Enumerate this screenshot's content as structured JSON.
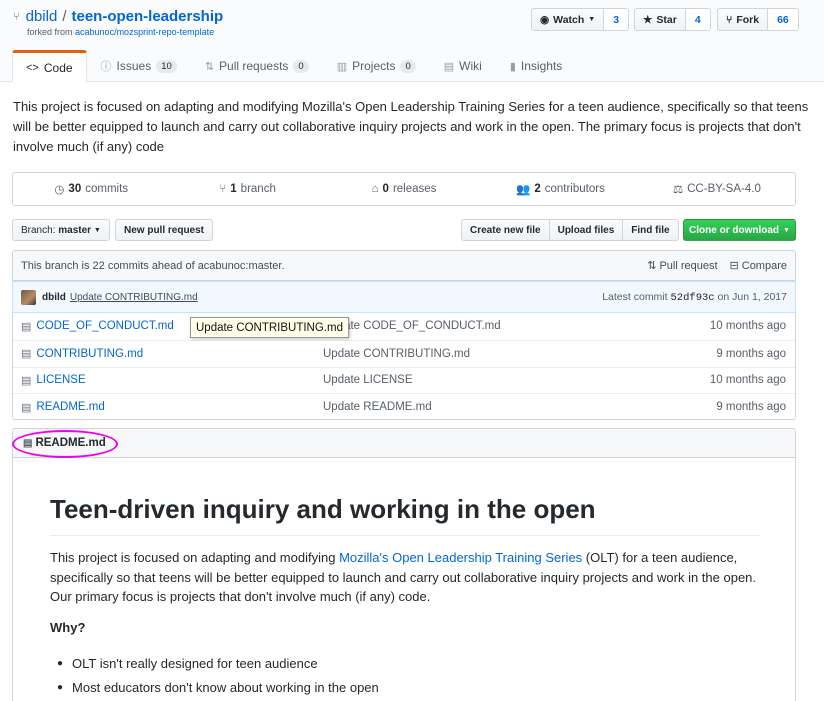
{
  "repo": {
    "owner": "dbild",
    "separator": "/",
    "name": "teen-open-leadership",
    "forked_prefix": "forked from",
    "forked_from": "acabunoc/mozsprint-repo-template"
  },
  "actions": {
    "watch_label": "Watch",
    "watch_count": "3",
    "star_label": "Star",
    "star_count": "4",
    "fork_label": "Fork",
    "fork_count": "66"
  },
  "tabs": [
    {
      "label": "Code",
      "icon": "code-icon"
    },
    {
      "label": "Issues",
      "count": "10",
      "icon": "issue-icon"
    },
    {
      "label": "Pull requests",
      "count": "0",
      "icon": "pull-request-icon"
    },
    {
      "label": "Projects",
      "count": "0",
      "icon": "project-icon"
    },
    {
      "label": "Wiki",
      "icon": "book-icon"
    },
    {
      "label": "Insights",
      "icon": "graph-icon"
    }
  ],
  "description": "This project is focused on adapting and modifying Mozilla's Open Leadership Training Series for a teen audience, specifically so that teens will be better equipped to launch and carry out collaborative inquiry projects and work in the open. The primary focus is projects that don't involve much (if any) code",
  "summary": {
    "commits_count": "30",
    "commits_label": "commits",
    "branch_count": "1",
    "branch_label": "branch",
    "releases_count": "0",
    "releases_label": "releases",
    "contributors_count": "2",
    "contributors_label": "contributors",
    "license": "CC-BY-SA-4.0"
  },
  "toolbar": {
    "branch_prefix": "Branch:",
    "branch_name": "master",
    "new_pr": "New pull request",
    "create_file": "Create new file",
    "upload_files": "Upload files",
    "find_file": "Find file",
    "clone": "Clone or download"
  },
  "branch_info": {
    "text": "This branch is 22 commits ahead of acabunoc:master.",
    "pull_request": "Pull request",
    "compare": "Compare"
  },
  "latest_commit": {
    "author": "dbild",
    "message": "Update CONTRIBUTING.md",
    "prefix": "Latest commit",
    "sha": "52df93c",
    "date": "on Jun 1, 2017"
  },
  "files": [
    {
      "name": "CODE_OF_CONDUCT.md",
      "message": "Update CODE_OF_CONDUCT.md",
      "age": "10 months ago"
    },
    {
      "name": "CONTRIBUTING.md",
      "message": "Update CONTRIBUTING.md",
      "age": "9 months ago"
    },
    {
      "name": "LICENSE",
      "message": "Update LICENSE",
      "age": "10 months ago"
    },
    {
      "name": "README.md",
      "message": "Update README.md",
      "age": "9 months ago"
    }
  ],
  "tooltip": "Update CONTRIBUTING.md",
  "readme": {
    "filename": "README.md",
    "title": "Teen-driven inquiry and working in the open",
    "p1_before": "This project is focused on adapting and modifying ",
    "p1_link": "Mozilla's Open Leadership Training Series",
    "p1_after": " (OLT) for a teen audience, specifically so that teens will be better equipped to launch and carry out collaborative inquiry projects and work in the open. Our primary focus is projects that don't involve much (if any) code.",
    "why": "Why?",
    "bullets": [
      "OLT isn't really designed for teen audience",
      "Most educators don't know about working in the open"
    ]
  },
  "colors": {
    "accent_link": "#0366d6",
    "tab_highlight": "#e36209",
    "clone_button": "#28a745",
    "annotation": "#f000f0"
  }
}
